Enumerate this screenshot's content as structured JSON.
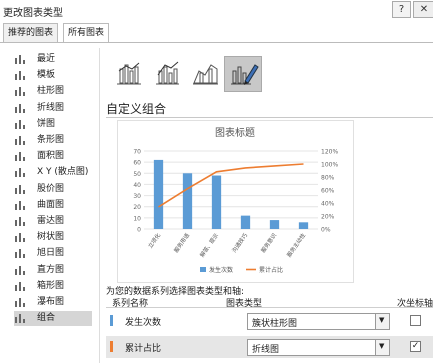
{
  "window": {
    "title": "更改图表类型",
    "help": "?",
    "close": "✕"
  },
  "tabs": [
    {
      "label": "推荐的图表"
    },
    {
      "label": "所有图表"
    }
  ],
  "types": [
    {
      "label": "最近",
      "icon": "recent-icon"
    },
    {
      "label": "模板",
      "icon": "folder-icon"
    },
    {
      "label": "柱形图",
      "icon": "column-chart-icon"
    },
    {
      "label": "折线图",
      "icon": "line-chart-icon"
    },
    {
      "label": "饼图",
      "icon": "pie-chart-icon"
    },
    {
      "label": "条形图",
      "icon": "bar-chart-icon"
    },
    {
      "label": "面积图",
      "icon": "area-chart-icon"
    },
    {
      "label": "X Y (散点图)",
      "icon": "scatter-chart-icon"
    },
    {
      "label": "股价图",
      "icon": "stock-chart-icon"
    },
    {
      "label": "曲面图",
      "icon": "surface-chart-icon"
    },
    {
      "label": "雷达图",
      "icon": "radar-chart-icon"
    },
    {
      "label": "树状图",
      "icon": "treemap-chart-icon"
    },
    {
      "label": "旭日图",
      "icon": "sunburst-chart-icon"
    },
    {
      "label": "直方图",
      "icon": "histogram-chart-icon"
    },
    {
      "label": "箱形图",
      "icon": "boxplot-chart-icon"
    },
    {
      "label": "瀑布图",
      "icon": "waterfall-chart-icon"
    },
    {
      "label": "组合",
      "icon": "combo-chart-icon"
    }
  ],
  "selected_type": "组合",
  "section_title": "自定义组合",
  "chart_data": {
    "type": "bar",
    "title": "图表标题",
    "categories": [
      "立项化",
      "服务用语",
      "解答、提示",
      "沟通技巧",
      "服务意识",
      "服务主动性"
    ],
    "series": [
      {
        "name": "发生次数",
        "kind": "bar",
        "axis": "primary",
        "values": [
          62,
          50,
          48,
          12,
          8,
          6
        ]
      },
      {
        "name": "累计占比",
        "kind": "line",
        "axis": "secondary",
        "values": [
          0.34,
          0.62,
          0.88,
          0.94,
          0.97,
          1.0
        ]
      }
    ],
    "ylim": [
      0,
      70
    ],
    "yticks": [
      "0",
      "10",
      "20",
      "30",
      "40",
      "50",
      "60",
      "70"
    ],
    "y2lim": [
      0,
      1.2
    ],
    "y2ticks": [
      "0%",
      "20%",
      "40%",
      "60%",
      "80%",
      "100%",
      "120%"
    ],
    "colors": {
      "bar": "#5b9bd5",
      "line": "#ed7d31"
    },
    "legend_position": "bottom"
  },
  "series_prompt": "为您的数据系列选择图表类型和轴:",
  "grid_headers": {
    "name": "系列名称",
    "type": "图表类型",
    "secondary": "次坐标轴"
  },
  "rows": [
    {
      "name": "发生次数",
      "color": "#5b9bd5",
      "chart_type": "簇状柱形图",
      "secondary_axis": false,
      "check": ""
    },
    {
      "name": "累计占比",
      "color": "#ed7d31",
      "chart_type": "折线图",
      "secondary_axis": true,
      "check": "✓"
    }
  ]
}
